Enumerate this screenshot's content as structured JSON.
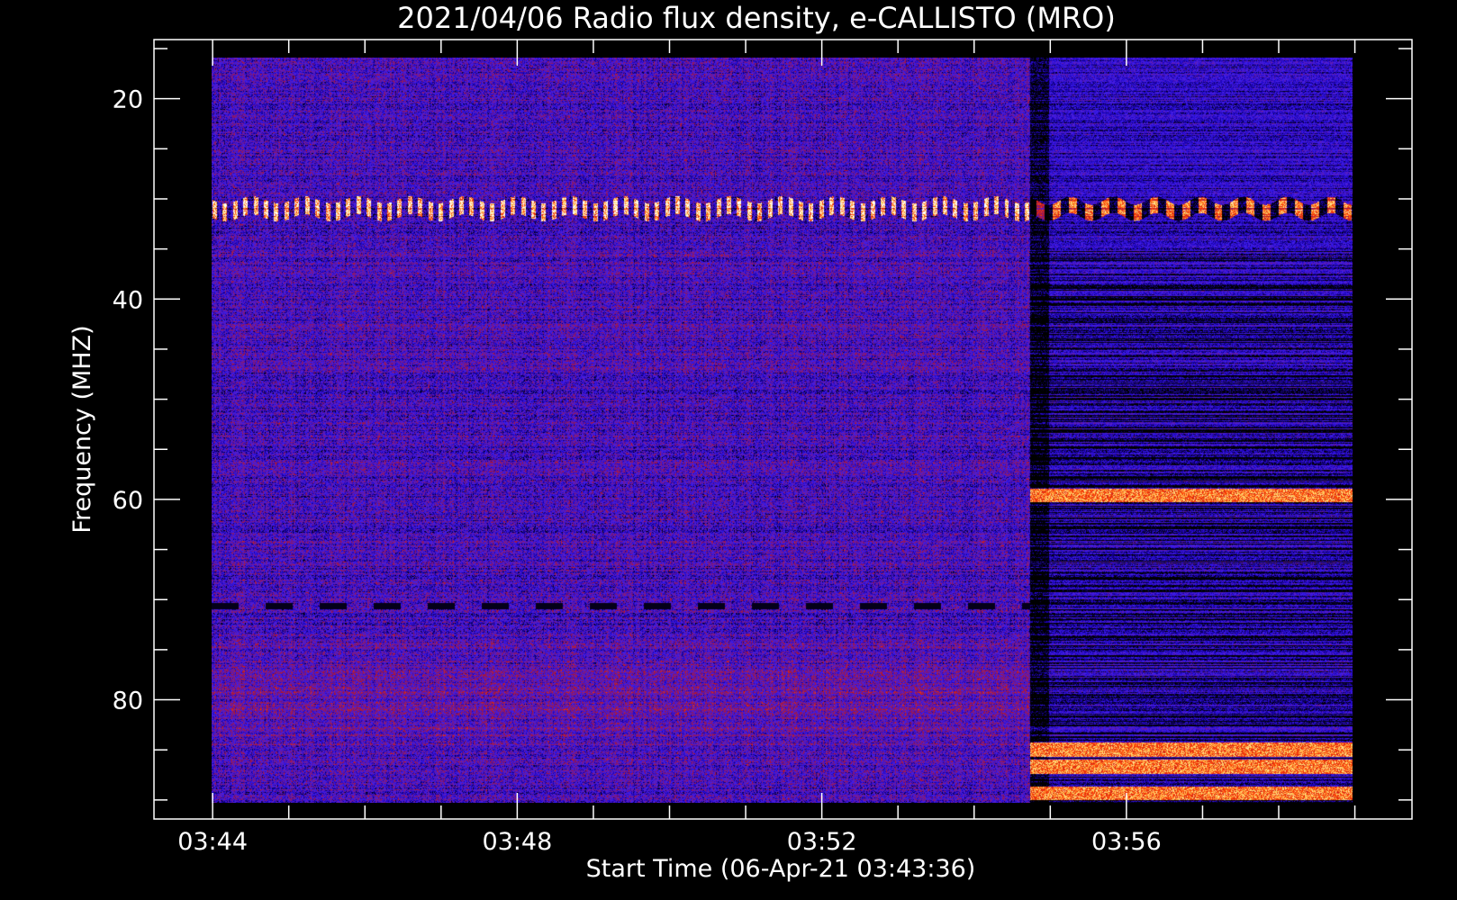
{
  "chart_data": {
    "type": "heatmap",
    "title": "2021/04/06  Radio flux density, e-CALLISTO (MRO)",
    "xlabel": "Start Time (06-Apr-21 03:43:36)",
    "ylabel": "Frequency (MHZ)",
    "x_tick_labels": [
      "03:44",
      "03:48",
      "03:52",
      "03:56"
    ],
    "x_tick_minutes": [
      0,
      4,
      8,
      12
    ],
    "x_minor_step_minutes": 1,
    "x_range_minutes": [
      -0.77,
      15.75
    ],
    "x_data_range_minutes": [
      0,
      15.0
    ],
    "y_tick_labels": [
      "20",
      "40",
      "60",
      "80"
    ],
    "y_ticks": [
      20,
      40,
      60,
      80
    ],
    "y_minor_step": 5,
    "y_range": [
      91.9,
      14.1
    ],
    "y_data_range": [
      90.0,
      15.9
    ],
    "y_inverted": true,
    "colormap": [
      "#000000",
      "#1a00b0",
      "#3c1ef0",
      "#6a1aa0",
      "#b0142a",
      "#ff3a00",
      "#ffd25a",
      "#ffffff"
    ],
    "features": {
      "event_onset_minutes": 10.75,
      "persistent_band_mhz": 30.9,
      "post_event_bright_bands_mhz": [
        59.4,
        84.7,
        86.4,
        89.0
      ]
    }
  }
}
